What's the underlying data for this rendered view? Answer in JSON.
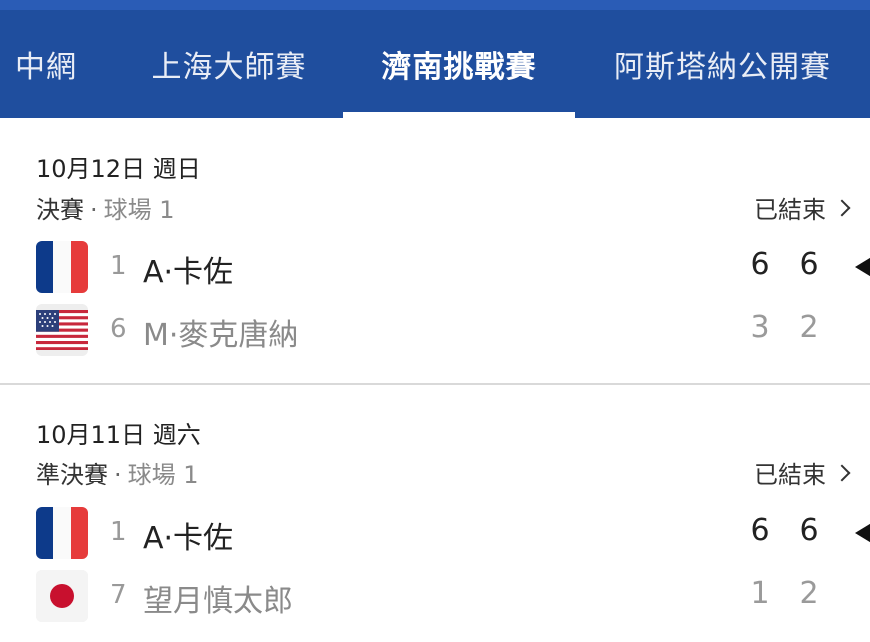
{
  "tabs": [
    {
      "label": "中網",
      "active": false
    },
    {
      "label": "上海大師賽",
      "active": false
    },
    {
      "label": "濟南挑戰賽",
      "active": true
    },
    {
      "label": "阿斯塔納公開賽",
      "active": false
    }
  ],
  "matches": [
    {
      "date": "10月12日 週日",
      "round": "決賽",
      "separator": "·",
      "court": "球場 1",
      "status": "已結束",
      "players": [
        {
          "flag": "france-flag-icon",
          "seed": "1",
          "name": "A·卡佐",
          "scores": [
            "6",
            "6"
          ],
          "winner": true
        },
        {
          "flag": "usa-flag-icon",
          "seed": "6",
          "name": "M·麥克唐納",
          "scores": [
            "3",
            "2"
          ],
          "winner": false
        }
      ]
    },
    {
      "date": "10月11日 週六",
      "round": "準決賽",
      "separator": "·",
      "court": "球場 1",
      "status": "已結束",
      "players": [
        {
          "flag": "france-flag-icon",
          "seed": "1",
          "name": "A·卡佐",
          "scores": [
            "6",
            "6"
          ],
          "winner": true
        },
        {
          "flag": "japan-flag-icon",
          "seed": "7",
          "name": "望月慎太郎",
          "scores": [
            "1",
            "2"
          ],
          "winner": false
        }
      ]
    }
  ],
  "colors": {
    "header_bg": "#1f4e9e",
    "france_blue": "#0d3a8a",
    "france_red": "#e63b3b",
    "usa_red": "#c8283c",
    "usa_blue": "#2c3f7a",
    "japan_red": "#c8102e"
  }
}
